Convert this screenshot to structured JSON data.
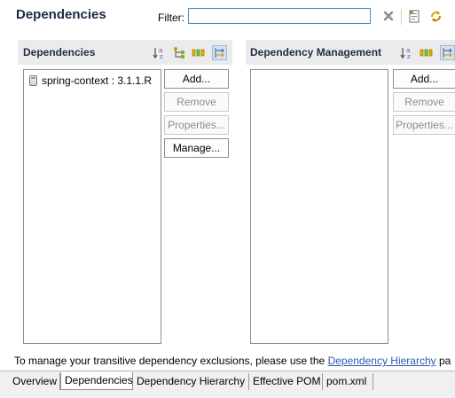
{
  "header": {
    "title": "Dependencies",
    "filter_label": "Filter:",
    "filter_value": "",
    "icons": [
      "clear-filter-icon",
      "open-pom-icon",
      "refresh-icon"
    ]
  },
  "dependencies_panel": {
    "title": "Dependencies",
    "toolbar_icons": [
      "sort-icon",
      "hierarchy-icon",
      "show-groupid-icon",
      "filter-toggle-icon"
    ],
    "items": [
      "spring-context : 3.1.1.R"
    ],
    "buttons": {
      "add": "Add...",
      "remove": "Remove",
      "properties": "Properties...",
      "manage": "Manage..."
    }
  },
  "management_panel": {
    "title": "Dependency Management",
    "toolbar_icons": [
      "sort-icon",
      "show-groupid-icon",
      "filter-toggle-icon"
    ],
    "items": [],
    "buttons": {
      "add": "Add...",
      "remove": "Remove",
      "properties": "Properties..."
    }
  },
  "footer": {
    "text_before": "To manage your transitive dependency exclusions, please use the ",
    "link": "Dependency Hierarchy",
    "text_after": " pa"
  },
  "tabs": [
    "Overview",
    "Dependencies",
    "Dependency Hierarchy",
    "Effective POM",
    "pom.xml"
  ],
  "selected_tab": "Dependencies",
  "colors": {
    "accent": "#4a89c4",
    "link": "#2a5db0",
    "panel_bar": "#ebebeb"
  }
}
